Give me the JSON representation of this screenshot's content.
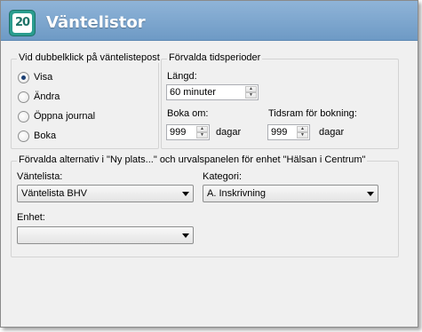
{
  "window": {
    "title": "Väntelistor",
    "logo_text": "20"
  },
  "double_click_group": {
    "legend": "Vid dubbelklick på väntelistepost",
    "options": [
      {
        "label": "Visa",
        "checked": true
      },
      {
        "label": "Ändra",
        "checked": false
      },
      {
        "label": "Öppna journal",
        "checked": false
      },
      {
        "label": "Boka",
        "checked": false
      }
    ]
  },
  "time_periods_group": {
    "legend": "Förvalda tidsperioder",
    "length_label": "Längd:",
    "length_value": "60 minuter",
    "book_in_label": "Boka om:",
    "book_in_value": "999",
    "book_in_unit": "dagar",
    "booking_window_label": "Tidsram för bokning:",
    "booking_window_value": "999",
    "booking_window_unit": "dagar"
  },
  "defaults_group": {
    "legend": "Förvalda alternativ i \"Ny plats...\" och urvalspanelen för enhet \"Hälsan i Centrum\"",
    "waitlist_label": "Väntelista:",
    "waitlist_value": "Väntelista BHV",
    "category_label": "Kategori:",
    "category_value": "A. Inskrivning",
    "unit_label": "Enhet:",
    "unit_value": ""
  }
}
